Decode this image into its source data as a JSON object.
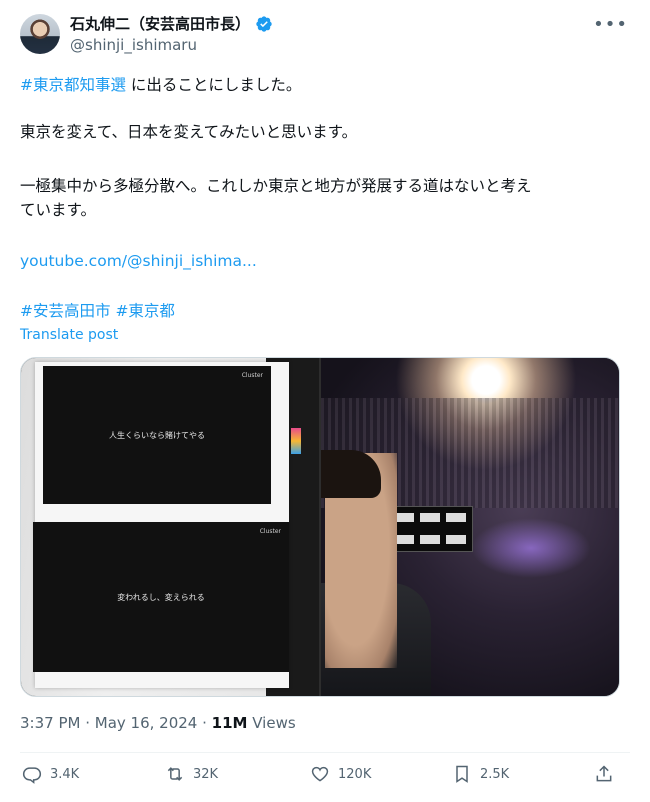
{
  "author": {
    "display_name": "石丸伸二（安芸高田市長）",
    "handle": "@shinji_ishimaru",
    "verified": true
  },
  "post": {
    "line1_tag": "#東京都知事選",
    "line1_rest": " に出ることにしました。",
    "line2": "東京を変えて、日本を変えてみたいと思います。",
    "line3a": "一極集中から多極分散へ。これしか東京と地方が発展する道はないと考え",
    "line3b": "ています。",
    "link": "youtube.com/@shinji_ishima...",
    "hashtag1": "#安芸高田市",
    "hashtag2": "#東京都",
    "translate": "Translate post"
  },
  "media": {
    "slide1_text": "人生くらいなら賭けてやる",
    "slide2_text": "変われるし、変えられる",
    "slide_logo": "Cluster"
  },
  "meta": {
    "time": "3:37 PM",
    "date": "May 16, 2024",
    "views_count": "11M",
    "views_label": "Views"
  },
  "actions": {
    "replies": "3.4K",
    "reposts": "32K",
    "likes": "120K",
    "bookmarks": "2.5K"
  },
  "colors": {
    "accent": "#1d9bf0",
    "text": "#0f1419",
    "muted": "#536471"
  }
}
